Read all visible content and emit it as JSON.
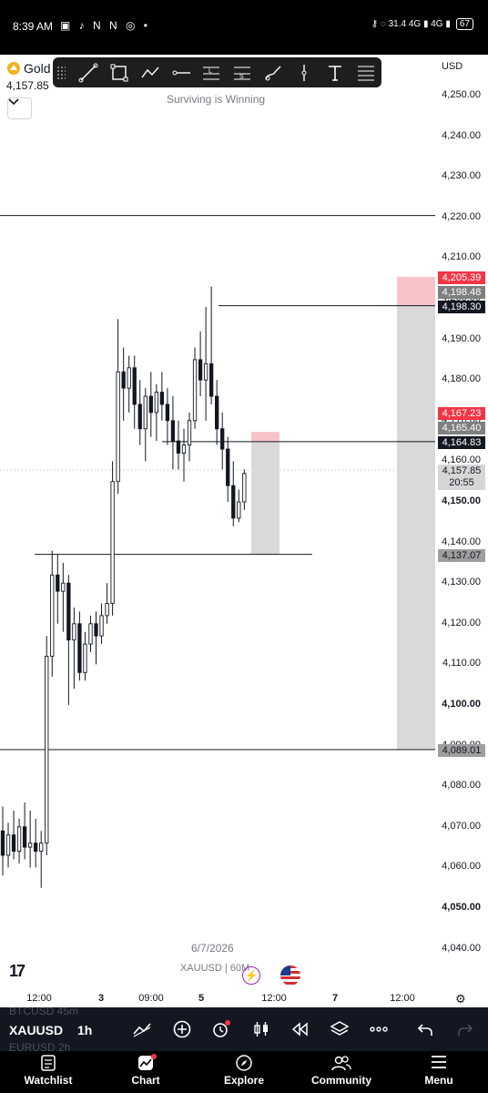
{
  "status_bar": {
    "time": "8:39 AM",
    "left_icons": "▣ ♪ N N ◎ •",
    "right_text": "⚷ ◌ 31.4 4G ▮ 4G ▮",
    "battery": "67"
  },
  "header": {
    "symbol": "Gold",
    "last_price": "4,157.85",
    "watermark": "Surviving is Winning",
    "currency": "USD",
    "collapse_icon": "chevron-down"
  },
  "drawing_tools": [
    "trend-line",
    "rectangle",
    "path",
    "horizontal-ray",
    "long-position",
    "short-position",
    "brush",
    "vertical-line",
    "text",
    "fib-retracement"
  ],
  "price_axis": {
    "labels": [
      "4,250.00",
      "4,240.00",
      "4,230.00",
      "4,220.00",
      "4,210.00",
      "4,200.00",
      "4,190.00",
      "4,180.00",
      "4,170.00",
      "4,160.00",
      "4,150.00",
      "4,140.00",
      "4,130.00",
      "4,120.00",
      "4,110.00",
      "4,100.00",
      "4,090.00",
      "4,080.00",
      "4,070.00",
      "4,060.00",
      "4,050.00",
      "4,040.00"
    ],
    "tags": {
      "t4205": "4,205.39",
      "t4198a": "4,198.48",
      "t4198b": "4,198.30",
      "t4167": "4,167.23",
      "t4165": "4,165.40",
      "t4164": "4,164.83",
      "current_price": "4,157.85",
      "countdown": "20:55",
      "t4137": "4,137.07",
      "t4089": "4,089.01"
    }
  },
  "time_axis": [
    "12:00",
    "3",
    "09:00",
    "5",
    "12:00",
    "7",
    "12:00"
  ],
  "chart_footer": {
    "date": "6/7/2026",
    "symbol_interval": "XAUUSD | 60M",
    "logo": "17"
  },
  "bottom_toolbar": {
    "ghost_above": "BTCUSD   45m",
    "ticker": "XAUUSD",
    "interval": "1h",
    "ghost_below": "EURUSD   2h"
  },
  "nav": [
    {
      "label": "Watchlist",
      "icon": "watchlist-icon"
    },
    {
      "label": "Chart",
      "icon": "chart-icon"
    },
    {
      "label": "Explore",
      "icon": "compass-icon"
    },
    {
      "label": "Community",
      "icon": "community-icon"
    },
    {
      "label": "Menu",
      "icon": "menu-icon"
    }
  ],
  "colors": {
    "up": "#ffffff",
    "down": "#131722",
    "short_target": "#d9d9d9",
    "short_stop": "#f7c5c9",
    "tag_red": "#f23645",
    "toolbar_bg": "#131722"
  },
  "chart_data": {
    "type": "candlestick",
    "symbol": "XAUUSD",
    "interval": "1h",
    "ylim": [
      4037,
      4252
    ],
    "candles": [
      {
        "o": 4069,
        "h": 4075,
        "l": 4058,
        "c": 4063
      },
      {
        "o": 4063,
        "h": 4071,
        "l": 4060,
        "c": 4068
      },
      {
        "o": 4068,
        "h": 4074,
        "l": 4062,
        "c": 4064
      },
      {
        "o": 4064,
        "h": 4072,
        "l": 4061,
        "c": 4070
      },
      {
        "o": 4070,
        "h": 4076,
        "l": 4062,
        "c": 4065
      },
      {
        "o": 4065,
        "h": 4074,
        "l": 4060,
        "c": 4066
      },
      {
        "o": 4066,
        "h": 4072,
        "l": 4060,
        "c": 4064
      },
      {
        "o": 4064,
        "h": 4069,
        "l": 4055,
        "c": 4066
      },
      {
        "o": 4066,
        "h": 4117,
        "l": 4063,
        "c": 4112
      },
      {
        "o": 4112,
        "h": 4138,
        "l": 4107,
        "c": 4132
      },
      {
        "o": 4132,
        "h": 4137,
        "l": 4120,
        "c": 4128
      },
      {
        "o": 4128,
        "h": 4135,
        "l": 4118,
        "c": 4130
      },
      {
        "o": 4130,
        "h": 4132,
        "l": 4100,
        "c": 4116
      },
      {
        "o": 4116,
        "h": 4124,
        "l": 4104,
        "c": 4120
      },
      {
        "o": 4120,
        "h": 4123,
        "l": 4106,
        "c": 4108
      },
      {
        "o": 4108,
        "h": 4118,
        "l": 4106,
        "c": 4115
      },
      {
        "o": 4115,
        "h": 4122,
        "l": 4113,
        "c": 4120
      },
      {
        "o": 4120,
        "h": 4123,
        "l": 4110,
        "c": 4117
      },
      {
        "o": 4117,
        "h": 4125,
        "l": 4115,
        "c": 4122
      },
      {
        "o": 4122,
        "h": 4130,
        "l": 4120,
        "c": 4125
      },
      {
        "o": 4125,
        "h": 4160,
        "l": 4122,
        "c": 4155
      },
      {
        "o": 4155,
        "h": 4195,
        "l": 4152,
        "c": 4182
      },
      {
        "o": 4182,
        "h": 4188,
        "l": 4170,
        "c": 4178
      },
      {
        "o": 4178,
        "h": 4186,
        "l": 4172,
        "c": 4183
      },
      {
        "o": 4183,
        "h": 4186,
        "l": 4168,
        "c": 4174
      },
      {
        "o": 4174,
        "h": 4180,
        "l": 4164,
        "c": 4168
      },
      {
        "o": 4168,
        "h": 4178,
        "l": 4160,
        "c": 4176
      },
      {
        "o": 4176,
        "h": 4182,
        "l": 4166,
        "c": 4172
      },
      {
        "o": 4172,
        "h": 4179,
        "l": 4165,
        "c": 4177
      },
      {
        "o": 4177,
        "h": 4182,
        "l": 4170,
        "c": 4174
      },
      {
        "o": 4174,
        "h": 4178,
        "l": 4164,
        "c": 4170
      },
      {
        "o": 4170,
        "h": 4176,
        "l": 4158,
        "c": 4165
      },
      {
        "o": 4165,
        "h": 4170,
        "l": 4158,
        "c": 4162
      },
      {
        "o": 4162,
        "h": 4168,
        "l": 4155,
        "c": 4164
      },
      {
        "o": 4164,
        "h": 4172,
        "l": 4160,
        "c": 4170
      },
      {
        "o": 4170,
        "h": 4188,
        "l": 4168,
        "c": 4185
      },
      {
        "o": 4185,
        "h": 4192,
        "l": 4176,
        "c": 4180
      },
      {
        "o": 4180,
        "h": 4198,
        "l": 4170,
        "c": 4184
      },
      {
        "o": 4184,
        "h": 4203,
        "l": 4174,
        "c": 4176
      },
      {
        "o": 4176,
        "h": 4180,
        "l": 4164,
        "c": 4168
      },
      {
        "o": 4168,
        "h": 4172,
        "l": 4158,
        "c": 4163
      },
      {
        "o": 4163,
        "h": 4166,
        "l": 4150,
        "c": 4154
      },
      {
        "o": 4154,
        "h": 4160,
        "l": 4144,
        "c": 4146
      },
      {
        "o": 4146,
        "h": 4153,
        "l": 4145,
        "c": 4150
      },
      {
        "o": 4150,
        "h": 4158,
        "l": 4148,
        "c": 4157
      }
    ],
    "horizontal_lines": [
      4220.5,
      4198.3,
      4164.83,
      4137.07,
      4089.01
    ],
    "positions": [
      {
        "entry": 4198.3,
        "stop": 4205.39,
        "target": 4089.01
      },
      {
        "entry": 4164.83,
        "stop": 4167.23,
        "target": 4137.07
      }
    ]
  }
}
